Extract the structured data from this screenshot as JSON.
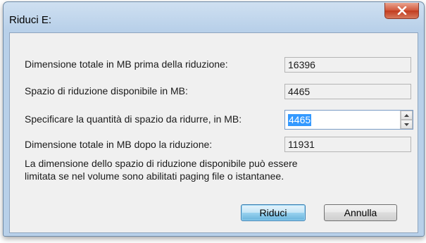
{
  "window": {
    "title": "Riduci E:"
  },
  "fields": [
    {
      "label": "Dimensione totale in MB prima della riduzione:",
      "value": "16396"
    },
    {
      "label": "Spazio di riduzione disponibile in MB:",
      "value": "4465"
    },
    {
      "label": "Specificare la quantità di spazio da ridurre, in MB:",
      "value": "4465"
    },
    {
      "label": "Dimensione totale in MB dopo la riduzione:",
      "value": "11931"
    }
  ],
  "info": "La dimensione dello spazio di riduzione disponibile può essere limitata se nel volume sono abilitati paging file o istantanee.",
  "buttons": {
    "ok": "Riduci",
    "cancel": "Annulla"
  },
  "icons": {
    "close": "close-icon",
    "spin_up": "chevron-up-icon",
    "spin_down": "chevron-down-icon"
  },
  "colors": {
    "close_button": "#c94a2c",
    "selection": "#3399ff"
  }
}
